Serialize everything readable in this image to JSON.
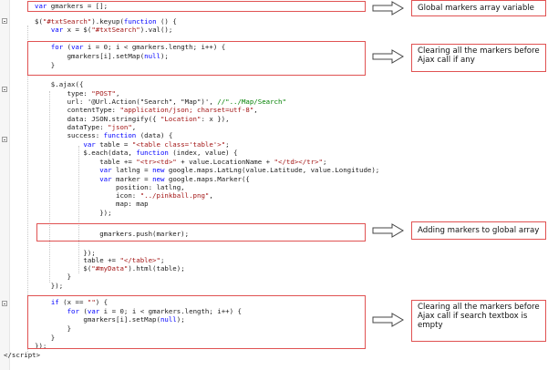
{
  "code": {
    "lines": [
      {
        "i": 1,
        "parts": [
          [
            "kw",
            "var"
          ],
          [
            "",
            " gmarkers = [];"
          ]
        ]
      },
      {
        "i": 2,
        "parts": [
          [
            "",
            ""
          ]
        ]
      },
      {
        "i": 3,
        "parts": [
          [
            "",
            "$("
          ],
          [
            "str",
            "\"#txtSearch\""
          ],
          [
            "",
            ").keyup("
          ],
          [
            "kw",
            "function"
          ],
          [
            "",
            " () {"
          ]
        ]
      },
      {
        "i": 4,
        "parts": [
          [
            "",
            "    "
          ],
          [
            "kw",
            "var"
          ],
          [
            "",
            " x = $("
          ],
          [
            "str",
            "\"#txtSearch\""
          ],
          [
            "",
            ").val();"
          ]
        ]
      },
      {
        "i": 5,
        "parts": [
          [
            "",
            ""
          ]
        ]
      },
      {
        "i": 6,
        "parts": [
          [
            "",
            "    "
          ],
          [
            "kw",
            "for"
          ],
          [
            "",
            " ("
          ],
          [
            "kw",
            "var"
          ],
          [
            "",
            " i = 0; i < gmarkers.length; i++) {"
          ]
        ]
      },
      {
        "i": 7,
        "parts": [
          [
            "",
            "        gmarkers[i].setMap("
          ],
          [
            "kw",
            "null"
          ],
          [
            "",
            ");"
          ]
        ]
      },
      {
        "i": 8,
        "parts": [
          [
            "",
            "    }"
          ]
        ]
      },
      {
        "i": 9,
        "parts": [
          [
            "",
            ""
          ]
        ]
      },
      {
        "i": 10,
        "parts": [
          [
            "",
            "    $.ajax({"
          ]
        ]
      },
      {
        "i": 11,
        "parts": [
          [
            "",
            "        type: "
          ],
          [
            "str",
            "\"POST\""
          ],
          [
            "",
            ","
          ]
        ]
      },
      {
        "i": 12,
        "parts": [
          [
            "",
            "        url: '"
          ],
          [
            "",
            "@Url.Action(\"Search\", \"Map\")"
          ],
          [
            "",
            "', "
          ],
          [
            "cmt",
            "//\"../Map/Search\""
          ]
        ]
      },
      {
        "i": 13,
        "parts": [
          [
            "",
            "        contentType: "
          ],
          [
            "str",
            "\"application/json; charset=utf-8\""
          ],
          [
            "",
            ","
          ]
        ]
      },
      {
        "i": 14,
        "parts": [
          [
            "",
            "        data: JSON.stringify({ "
          ],
          [
            "str",
            "\"Location\""
          ],
          [
            "",
            ": x }),"
          ]
        ]
      },
      {
        "i": 15,
        "parts": [
          [
            "",
            "        dataType: "
          ],
          [
            "str",
            "\"json\""
          ],
          [
            "",
            ","
          ]
        ]
      },
      {
        "i": 16,
        "parts": [
          [
            "",
            "        success: "
          ],
          [
            "kw",
            "function"
          ],
          [
            "",
            " (data) {"
          ]
        ]
      },
      {
        "i": 17,
        "parts": [
          [
            "",
            "            "
          ],
          [
            "kw",
            "var"
          ],
          [
            "",
            " table = "
          ],
          [
            "str",
            "\"<table class='table'>\""
          ],
          [
            "",
            ";"
          ]
        ]
      },
      {
        "i": 18,
        "parts": [
          [
            "",
            "            $.each(data, "
          ],
          [
            "kw",
            "function"
          ],
          [
            "",
            " (index, value) {"
          ]
        ]
      },
      {
        "i": 19,
        "parts": [
          [
            "",
            "                table += "
          ],
          [
            "str",
            "\"<tr><td>\""
          ],
          [
            "",
            " + value.LocationName + "
          ],
          [
            "str",
            "\"</td></tr>\""
          ],
          [
            "",
            ";"
          ]
        ]
      },
      {
        "i": 20,
        "parts": [
          [
            "",
            "                "
          ],
          [
            "kw",
            "var"
          ],
          [
            "",
            " latlng = "
          ],
          [
            "kw",
            "new"
          ],
          [
            "",
            " google.maps.LatLng(value.Latitude, value.Longitude);"
          ]
        ]
      },
      {
        "i": 21,
        "parts": [
          [
            "",
            "                "
          ],
          [
            "kw",
            "var"
          ],
          [
            "",
            " marker = "
          ],
          [
            "kw",
            "new"
          ],
          [
            "",
            " google.maps.Marker({"
          ]
        ]
      },
      {
        "i": 22,
        "parts": [
          [
            "",
            "                    position: latlng,"
          ]
        ]
      },
      {
        "i": 23,
        "parts": [
          [
            "",
            "                    icon: "
          ],
          [
            "str",
            "\"../pinkball.png\""
          ],
          [
            "",
            ","
          ]
        ]
      },
      {
        "i": 24,
        "parts": [
          [
            "",
            "                    map: map"
          ]
        ]
      },
      {
        "i": 25,
        "parts": [
          [
            "",
            "                });"
          ]
        ]
      },
      {
        "i": 26,
        "parts": [
          [
            "",
            ""
          ]
        ]
      },
      {
        "i": 27,
        "parts": [
          [
            "",
            "                gmarkers.push(marker);"
          ]
        ]
      },
      {
        "i": 28,
        "parts": [
          [
            "",
            ""
          ]
        ]
      },
      {
        "i": 29,
        "parts": [
          [
            "",
            "            });"
          ]
        ]
      },
      {
        "i": 30,
        "parts": [
          [
            "",
            "            table += "
          ],
          [
            "str",
            "\"</table>\""
          ],
          [
            "",
            ";"
          ]
        ]
      },
      {
        "i": 31,
        "parts": [
          [
            "",
            "            $("
          ],
          [
            "str",
            "\"#myData\""
          ],
          [
            "",
            ").html(table);"
          ]
        ]
      },
      {
        "i": 32,
        "parts": [
          [
            "",
            "        }"
          ]
        ]
      },
      {
        "i": 33,
        "parts": [
          [
            "",
            "    });"
          ]
        ]
      },
      {
        "i": 34,
        "parts": [
          [
            "",
            ""
          ]
        ]
      },
      {
        "i": 35,
        "parts": [
          [
            "",
            "    "
          ],
          [
            "kw",
            "if"
          ],
          [
            "",
            " (x == "
          ],
          [
            "str",
            "\"\""
          ],
          [
            "",
            ") {"
          ]
        ]
      },
      {
        "i": 36,
        "parts": [
          [
            "",
            "        "
          ],
          [
            "kw",
            "for"
          ],
          [
            "",
            " ("
          ],
          [
            "kw",
            "var"
          ],
          [
            "",
            " i = 0; i < gmarkers.length; i++) {"
          ]
        ]
      },
      {
        "i": 37,
        "parts": [
          [
            "",
            "            gmarkers[i].setMap("
          ],
          [
            "kw",
            "null"
          ],
          [
            "",
            ");"
          ]
        ]
      },
      {
        "i": 38,
        "parts": [
          [
            "",
            "        }"
          ]
        ]
      },
      {
        "i": 39,
        "parts": [
          [
            "",
            "    }"
          ]
        ]
      },
      {
        "i": 40,
        "parts": [
          [
            "",
            "});"
          ]
        ]
      },
      {
        "i": 41,
        "parts": [
          [
            "",
            "</"
          ],
          [
            "",
            "script"
          ],
          [
            "",
            ">"
          ]
        ]
      }
    ]
  },
  "annotations": {
    "global_markers": "Global markers array variable",
    "clear_before_ajax": "Clearing all the markers before Ajax call if any",
    "adding_markers": "Adding markers to global array",
    "clear_if_empty": "Clearing all the markers before Ajax call if search textbox is empty"
  },
  "colors": {
    "highlight_border": "#e05252",
    "keyword": "#0000ff",
    "string": "#a31515",
    "comment": "#008000"
  }
}
